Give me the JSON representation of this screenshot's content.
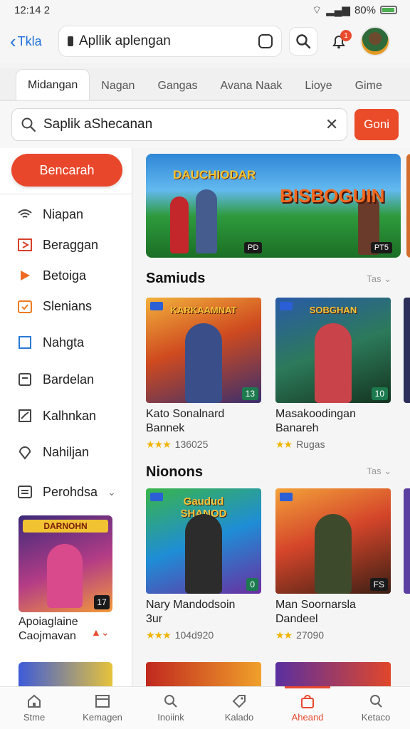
{
  "status": {
    "time": "12:14",
    "extra": "2",
    "battery": "80%"
  },
  "appbar": {
    "back_label": "Tkla",
    "url_text": "Apllik aplengan",
    "notif_count": "1"
  },
  "tabs": [
    "Midangan",
    "Nagan",
    "Gangas",
    "Avana Naak",
    "Lioye",
    "Gime"
  ],
  "search": {
    "value": "Saplik aShecanan",
    "go_label": "Goni"
  },
  "sidebar": {
    "primary_button": "Bencarah",
    "items": [
      {
        "label": "Niapan",
        "icon": "wifi-icon"
      },
      {
        "label": "Beraggan",
        "icon": "play-square-icon"
      },
      {
        "label": "Betoiga",
        "icon": "play-icon"
      },
      {
        "label": "Slenians",
        "icon": "calendar-icon"
      },
      {
        "label": "Nahgta",
        "icon": "square-icon"
      },
      {
        "label": "Bardelan",
        "icon": "inbox-icon"
      },
      {
        "label": "Kalhnkan",
        "icon": "chart-icon"
      },
      {
        "label": "Nahiljan",
        "icon": "location-icon"
      },
      {
        "label": "Perohdsa",
        "icon": "list-icon"
      }
    ],
    "promo": {
      "title": "DARNOHN",
      "badge": "17",
      "line1": "Apoiaglaine",
      "line2": "Caojmavan"
    }
  },
  "hero": {
    "title_left": "DAUCHIODAR",
    "title_right": "BISBOGUIN",
    "badge_left": "PD",
    "badge_right": "PT5"
  },
  "sections": [
    {
      "title": "Samiuds",
      "more": "Tas",
      "cards": [
        {
          "thumb_title": "KARKAAMNAT",
          "count": "13",
          "name1": "Kato Sonalnard",
          "name2": "Bannek",
          "stars": "★★★",
          "rating": "136025"
        },
        {
          "thumb_title": "SOBGHAN",
          "count": "10",
          "name1": "Masakoodingan",
          "name2": "Banareh",
          "stars": "★★",
          "rating": "Rugas"
        }
      ]
    },
    {
      "title": "Nionons",
      "more": "Tas",
      "cards": [
        {
          "thumb_title": "Gaudud SHANOD",
          "count": "0",
          "name1": "Nary Mandodsoin",
          "name2": "3ur",
          "stars": "★★★",
          "rating": "104d920"
        },
        {
          "thumb_title": "",
          "count": "FS",
          "name1": "Man Soornarsla",
          "name2": "Dandeel",
          "stars": "★★",
          "rating": "27090"
        }
      ]
    }
  ],
  "bottomnav": [
    {
      "label": "Stme",
      "icon": "home-icon"
    },
    {
      "label": "Kemagen",
      "icon": "browser-icon"
    },
    {
      "label": "Inoiink",
      "icon": "search-icon"
    },
    {
      "label": "Kalado",
      "icon": "tag-icon"
    },
    {
      "label": "Aheand",
      "icon": "store-icon",
      "active": true
    },
    {
      "label": "Ketaco",
      "icon": "magnifier-icon"
    }
  ]
}
